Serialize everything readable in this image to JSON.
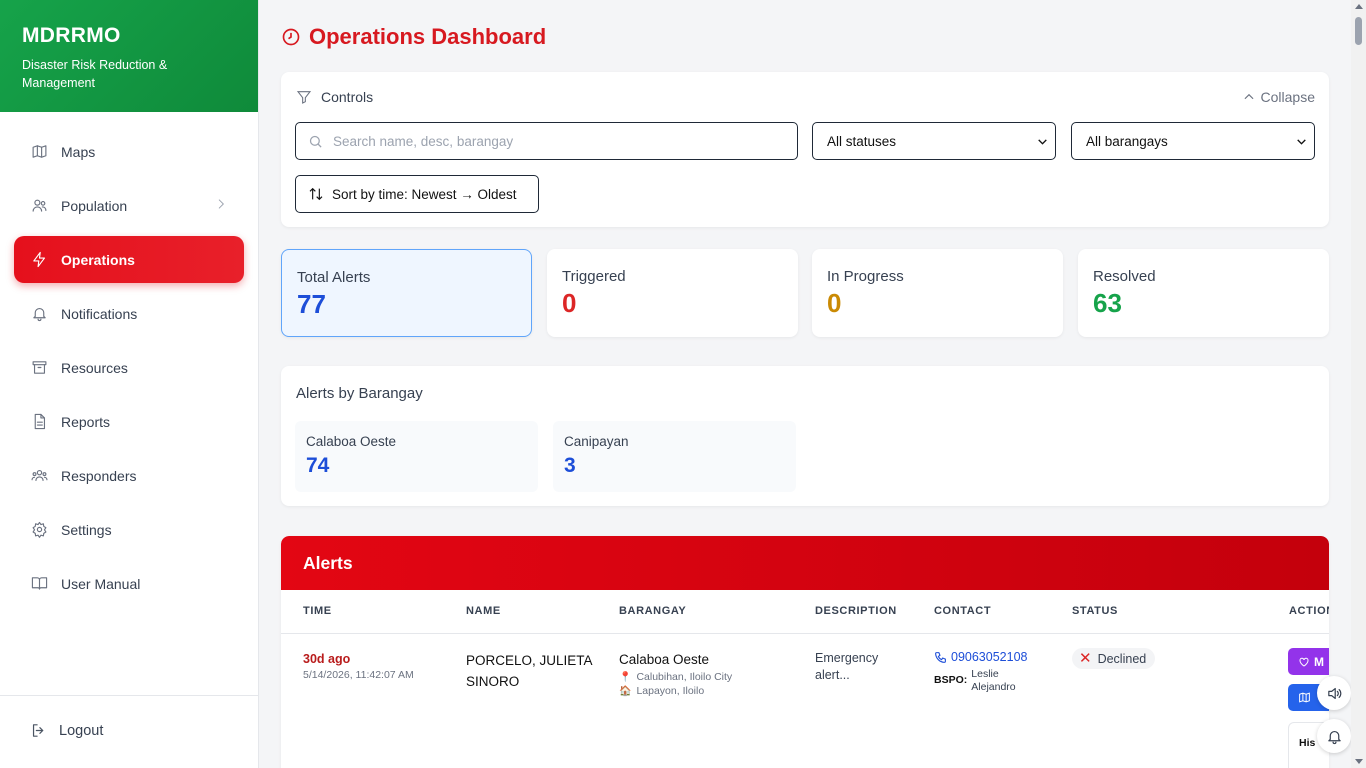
{
  "brand": {
    "title": "MDRRMO",
    "subtitle": "Disaster Risk Reduction & Management",
    "color": "#16a34a"
  },
  "sidebar": {
    "items": [
      {
        "label": "Maps",
        "icon": "map-icon"
      },
      {
        "label": "Population",
        "icon": "users-icon"
      },
      {
        "label": "Operations",
        "icon": "lightning-icon",
        "active": true
      },
      {
        "label": "Notifications",
        "icon": "bell-icon"
      },
      {
        "label": "Resources",
        "icon": "archive-icon"
      },
      {
        "label": "Reports",
        "icon": "document-icon"
      },
      {
        "label": "Responders",
        "icon": "team-icon"
      },
      {
        "label": "Settings",
        "icon": "gear-icon"
      },
      {
        "label": "User Manual",
        "icon": "book-icon"
      }
    ],
    "logout_label": "Logout",
    "active_color": "#e5101c"
  },
  "header": {
    "title": "Operations Dashboard"
  },
  "controls": {
    "title": "Controls",
    "collapse_label": "Collapse",
    "search_placeholder": "Search name, desc, barangay",
    "status_value": "All statuses",
    "barangay_value": "All barangays",
    "sort_label": "Sort by time: Newest → Oldest"
  },
  "stats": {
    "total": {
      "label": "Total Alerts",
      "value": "77"
    },
    "triggered": {
      "label": "Triggered",
      "value": "0"
    },
    "in_progress": {
      "label": "In Progress",
      "value": "0"
    },
    "resolved": {
      "label": "Resolved",
      "value": "63"
    }
  },
  "by_barangay": {
    "title": "Alerts by Barangay",
    "items": [
      {
        "name": "Calaboa Oeste",
        "count": "74"
      },
      {
        "name": "Canipayan",
        "count": "3"
      }
    ]
  },
  "alerts": {
    "title": "Alerts",
    "columns": [
      "TIME",
      "NAME",
      "BARANGAY",
      "DESCRIPTION",
      "CONTACT",
      "STATUS",
      "ACTION"
    ],
    "rows": [
      {
        "time_ago": "30d ago",
        "time_abs": "5/14/2026, 11:42:07 AM",
        "name": "PORCELO, JULIETA SINORO",
        "barangay": "Calaboa Oeste",
        "location_1": "Calubihan, Iloilo City",
        "location_2": "Lapayon, Iloilo",
        "description": "Emergency alert...",
        "phone": "09063052108",
        "bspo_label": "BSPO:",
        "bspo_name": "Leslie Alejandro",
        "status": "Declined",
        "action_1": "M",
        "history": "His"
      }
    ]
  }
}
